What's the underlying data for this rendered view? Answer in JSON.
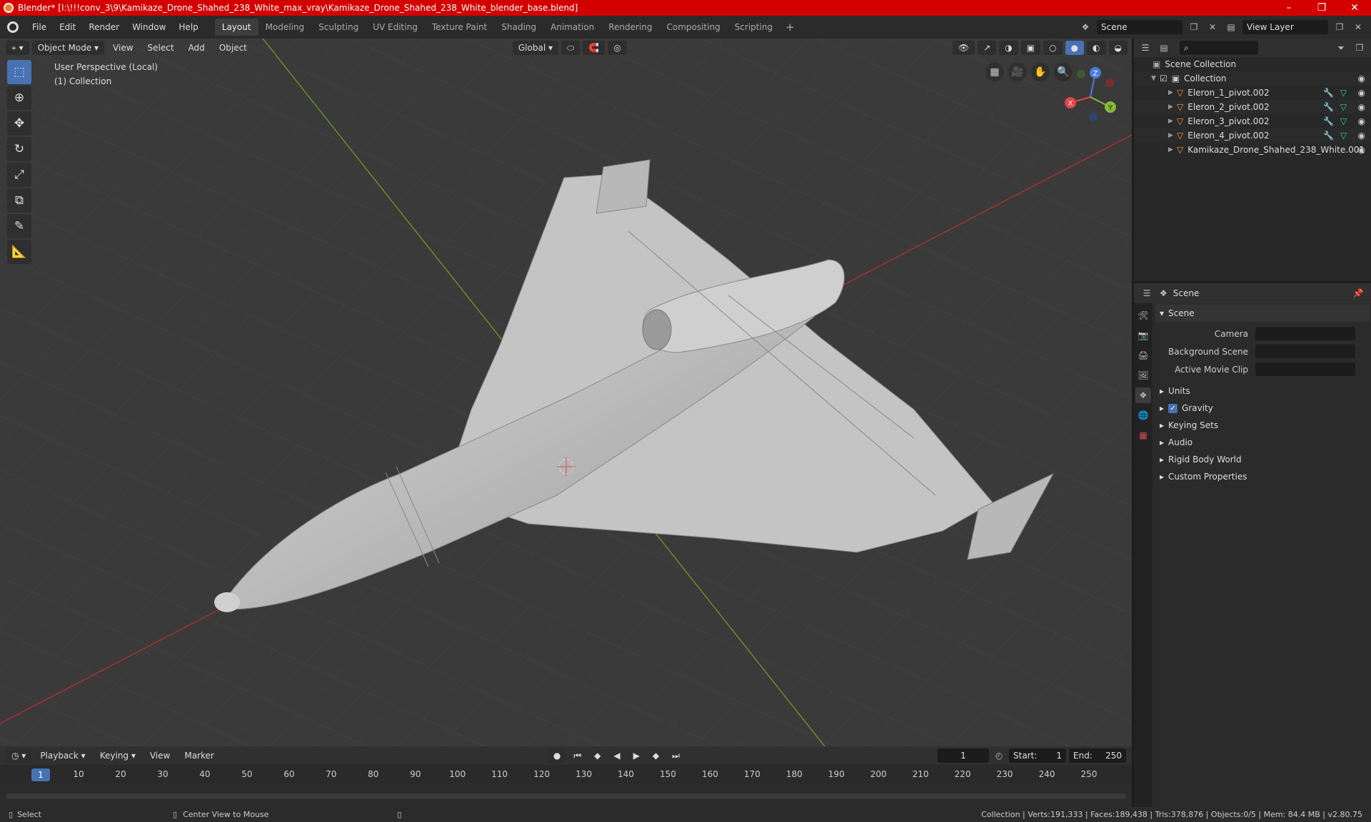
{
  "window": {
    "title": "Blender* [I:\\!!!conv_3\\9\\Kamikaze_Drone_Shahed_238_White_max_vray\\Kamikaze_Drone_Shahed_238_White_blender_base.blend]"
  },
  "menu": [
    "File",
    "Edit",
    "Render",
    "Window",
    "Help"
  ],
  "workspaces": [
    "Layout",
    "Modeling",
    "Sculpting",
    "UV Editing",
    "Texture Paint",
    "Shading",
    "Animation",
    "Rendering",
    "Compositing",
    "Scripting"
  ],
  "scene_name": "Scene",
  "view_layer": "View Layer",
  "viewport": {
    "mode": "Object Mode",
    "menus": [
      "View",
      "Select",
      "Add",
      "Object"
    ],
    "orientation": "Global",
    "info_line1": "User Perspective (Local)",
    "info_line2": "(1) Collection",
    "gizmo": {
      "x": "X",
      "y": "Y",
      "z": "Z"
    }
  },
  "outliner": {
    "root": "Scene Collection",
    "collection": "Collection",
    "objects": [
      "Eleron_1_pivot.002",
      "Eleron_2_pivot.002",
      "Eleron_3_pivot.002",
      "Eleron_4_pivot.002",
      "Kamikaze_Drone_Shahed_238_White.001"
    ]
  },
  "properties": {
    "header": "Scene",
    "section": "Scene",
    "fields": {
      "camera": "Camera",
      "background_scene": "Background Scene",
      "active_movie_clip": "Active Movie Clip"
    },
    "subsections": [
      "Units",
      "Gravity",
      "Keying Sets",
      "Audio",
      "Rigid Body World",
      "Custom Properties"
    ]
  },
  "timeline": {
    "menus": [
      "Playback",
      "Keying",
      "View",
      "Marker"
    ],
    "current_frame": "1",
    "start_label": "Start:",
    "start": "1",
    "end_label": "End:",
    "end": "250",
    "ticks": [
      "10",
      "20",
      "30",
      "40",
      "50",
      "60",
      "70",
      "80",
      "90",
      "100",
      "110",
      "120",
      "130",
      "140",
      "150",
      "160",
      "170",
      "180",
      "190",
      "200",
      "210",
      "220",
      "230",
      "240",
      "250"
    ]
  },
  "status": {
    "select": "Select",
    "center": "Center View to Mouse",
    "stats": "Collection | Verts:191,333 | Faces:189,438 | Tris:378,876 | Objects:0/5 | Mem: 84.4 MB | v2.80.75"
  }
}
